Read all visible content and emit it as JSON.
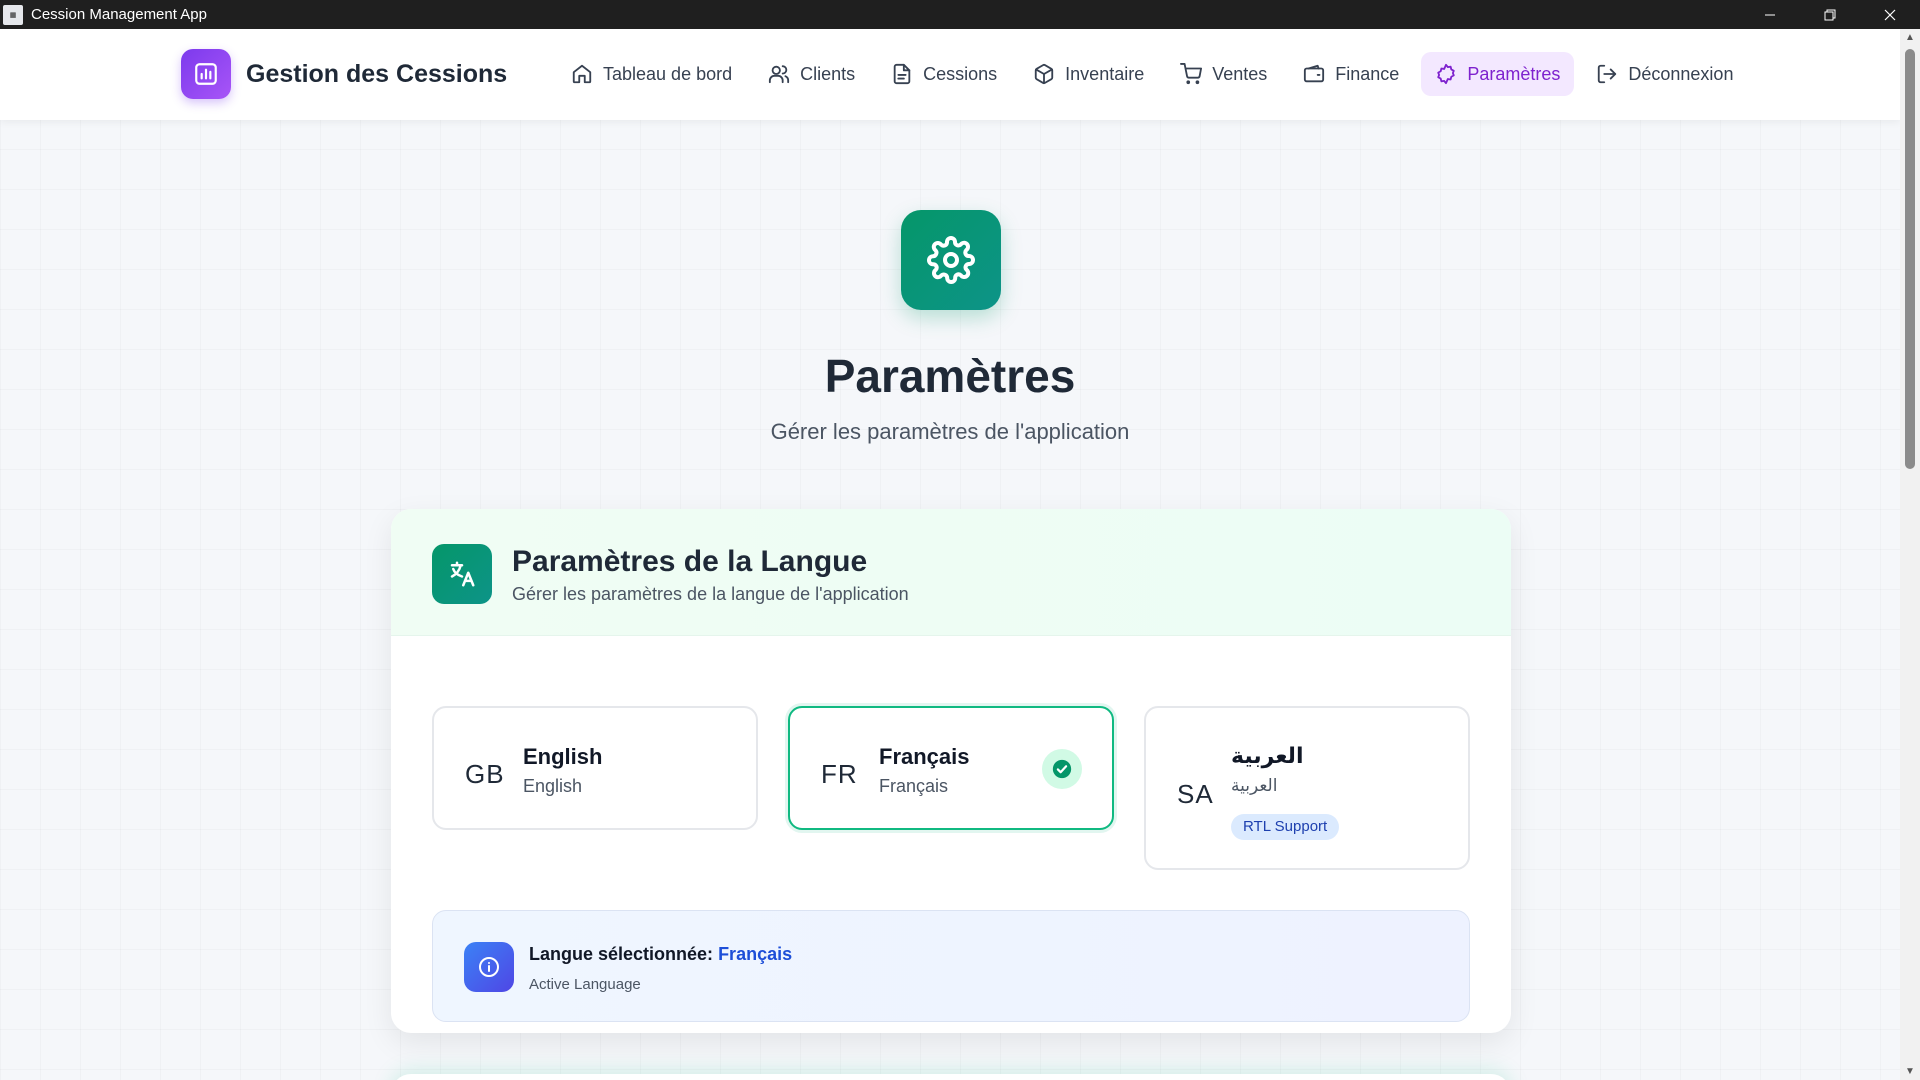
{
  "window": {
    "title": "Cession Management App",
    "controls": [
      "—",
      "❐",
      "✕"
    ]
  },
  "brand": {
    "name": "Gestion des Cessions",
    "icon": "bar-chart-icon",
    "color": "#7c3aed"
  },
  "nav": {
    "items": [
      {
        "label": "Tableau de bord",
        "icon": "home-icon"
      },
      {
        "label": "Clients",
        "icon": "users-icon"
      },
      {
        "label": "Cessions",
        "icon": "file-icon"
      },
      {
        "label": "Inventaire",
        "icon": "box-icon"
      },
      {
        "label": "Ventes",
        "icon": "cart-icon"
      },
      {
        "label": "Finance",
        "icon": "wallet-icon"
      },
      {
        "label": "Paramètres",
        "icon": "settings-icon",
        "active": true
      },
      {
        "label": "Déconnexion",
        "icon": "logout-icon"
      }
    ]
  },
  "header": {
    "title": "Paramètres",
    "subtitle": "Gérer les paramètres de l'application",
    "icon": "gear-icon"
  },
  "language_card": {
    "title": "Paramètres de la Langue",
    "subtitle": "Gérer les paramètres de la langue de l'application",
    "icon": "translate-icon",
    "options": [
      {
        "code": "GB",
        "name": "English",
        "native": "English",
        "selected": false
      },
      {
        "code": "FR",
        "name": "Français",
        "native": "Français",
        "selected": true
      },
      {
        "code": "SA",
        "name": "العربية",
        "native": "العربية",
        "badge": "RTL Support",
        "selected": false
      }
    ],
    "info": {
      "label": "Langue sélectionnée:",
      "value": "Français",
      "sub": "Active Language"
    }
  },
  "colors": {
    "accent": "#10b981",
    "active_nav": "#7e22ce",
    "info_value": "#1d4ed8"
  }
}
